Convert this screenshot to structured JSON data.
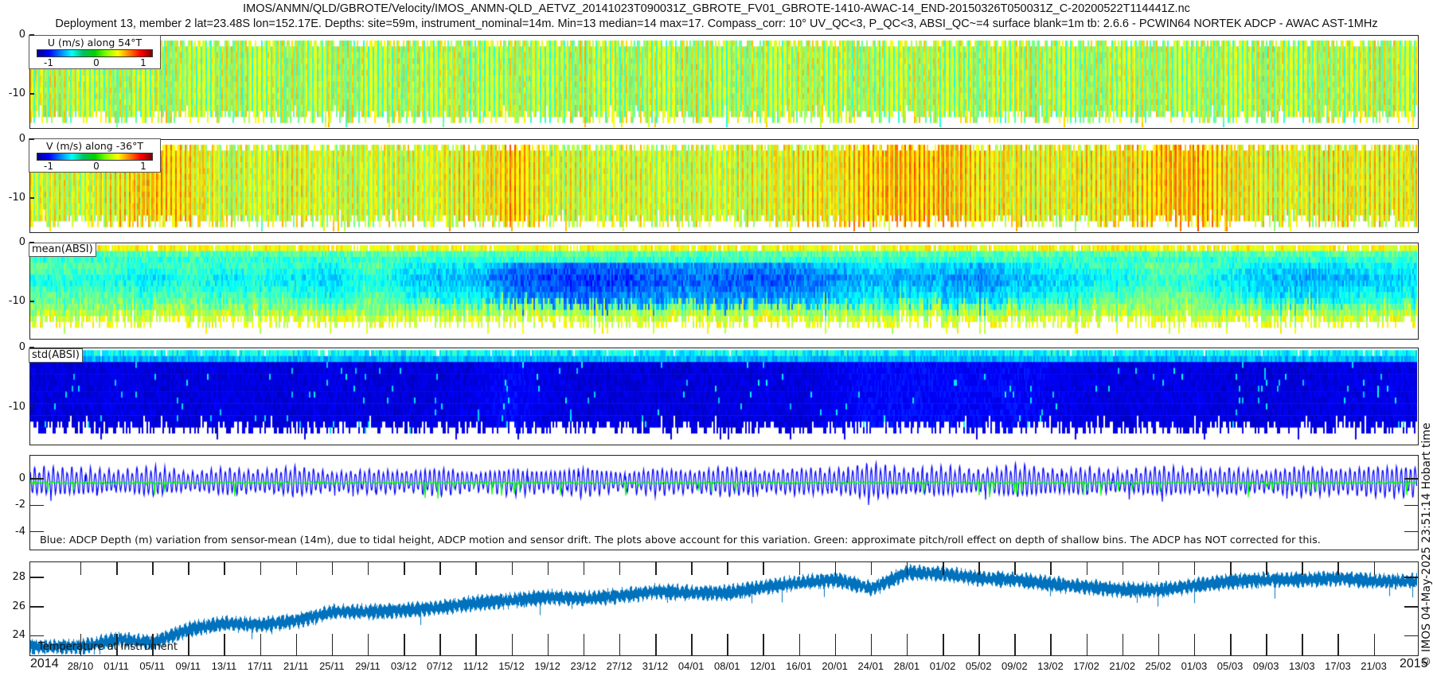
{
  "title_line1": "IMOS/ANMN/QLD/GBROTE/Velocity/IMOS_ANMN-QLD_AETVZ_20141023T090031Z_GBROTE_FV01_GBROTE-1410-AWAC-14_END-20150326T050031Z_C-20200522T114441Z.nc",
  "title_line2": "Deployment 13, member 2 lat=23.48S lon=152.17E. Depths: site=59m, instrument_nominal=14m. Min=13 median=14 max=17. Compass_corr: 10° UV_QC<3, P_QC<3, ABSI_QC~=4 surface blank=1m tb: 2.6.6 - PCWIN64 NORTEK ADCP - AWAC AST-1MHz",
  "timestamp_note": "© IMOS 04-May-2025 23:51:14 Hobart time",
  "x_axis": {
    "year_start": "2014",
    "year_end": "2015",
    "tick_labels": [
      "28/10",
      "01/11",
      "05/11",
      "09/11",
      "13/11",
      "17/11",
      "21/11",
      "25/11",
      "29/11",
      "03/12",
      "07/12",
      "11/12",
      "15/12",
      "19/12",
      "23/12",
      "27/12",
      "31/12",
      "04/01",
      "08/01",
      "12/01",
      "16/01",
      "20/01",
      "24/01",
      "28/01",
      "01/02",
      "05/02",
      "09/02",
      "13/02",
      "17/02",
      "21/02",
      "25/02",
      "01/03",
      "05/03",
      "09/03",
      "13/03",
      "17/03",
      "21/03"
    ],
    "tick_days_from_28_10": [
      0,
      4,
      8,
      12,
      16,
      20,
      24,
      28,
      32,
      36,
      40,
      44,
      48,
      52,
      56,
      60,
      64,
      68,
      72,
      76,
      80,
      84,
      88,
      92,
      96,
      100,
      104,
      108,
      112,
      116,
      120,
      124,
      128,
      132,
      136,
      140,
      144
    ],
    "xlim_days_from_28_10": [
      -5.67,
      149.0
    ]
  },
  "colors": {
    "tide_depth": "#0000ff",
    "pitch_roll": "#00ff00",
    "temperature": "#0072bd",
    "axis": "#222222"
  },
  "chart_data": [
    {
      "type": "heatmap",
      "name": "U",
      "colorbar_title": "U (m/s) along 54°T",
      "colorbar_ticks": [
        "-1",
        "0",
        "1"
      ],
      "clim": [
        -1.25,
        1.25
      ],
      "ylim": [
        -16,
        0
      ],
      "ytick_labels": [
        "0",
        "-10"
      ],
      "yticks": [
        0,
        -10
      ],
      "level_by_tick": [
        0.15,
        0.1,
        0.15,
        0.1,
        0.15,
        0.1,
        0.12,
        0.15,
        0.1,
        0.12,
        0.15,
        0.1,
        0.12,
        0.1,
        0.15,
        0.1,
        0.12,
        0.15,
        0.1,
        0.12,
        0.15,
        0.12,
        0.1,
        0.15,
        0.12,
        0.1,
        0.15,
        0.12,
        0.1,
        0.15,
        0.12,
        0.1,
        0.12,
        0.15,
        0.1,
        0.12,
        0.15
      ],
      "tidal_amplitude": 0.35
    },
    {
      "type": "heatmap",
      "name": "V",
      "colorbar_title": "V (m/s) along -36°T",
      "colorbar_ticks": [
        "-1",
        "0",
        "1"
      ],
      "clim": [
        -1.25,
        1.25
      ],
      "ylim": [
        -16,
        0
      ],
      "ytick_labels": [
        "0",
        "-10"
      ],
      "yticks": [
        0,
        -10
      ],
      "level_by_tick": [
        0.2,
        0.3,
        0.45,
        0.35,
        0.2,
        0.2,
        0.25,
        0.2,
        0.2,
        0.2,
        0.25,
        0.3,
        0.45,
        0.25,
        0.2,
        0.2,
        0.2,
        0.2,
        0.2,
        0.25,
        0.3,
        0.35,
        0.45,
        0.5,
        0.45,
        0.35,
        0.3,
        0.25,
        0.3,
        0.35,
        0.45,
        0.5,
        0.35,
        0.25,
        0.25,
        0.3,
        0.3
      ],
      "tidal_amplitude": 0.3
    },
    {
      "type": "heatmap",
      "name": "mean(ABSI)",
      "label": "mean(ABSI)",
      "clim": [
        0,
        1
      ],
      "ylim": [
        -16.5,
        0
      ],
      "ytick_labels": [
        "0",
        "-10"
      ],
      "yticks": [
        0,
        -10
      ],
      "level_by_tick": [
        0.4,
        0.38,
        0.35,
        0.4,
        0.35,
        0.38,
        0.35,
        0.32,
        0.42,
        0.33,
        0.3,
        0.3,
        0.2,
        0.17,
        0.17,
        0.17,
        0.2,
        0.22,
        0.2,
        0.2,
        0.22,
        0.25,
        0.3,
        0.28,
        0.28,
        0.25,
        0.3,
        0.32,
        0.35,
        0.38,
        0.42,
        0.4,
        0.35,
        0.3,
        0.28,
        0.3,
        0.32
      ]
    },
    {
      "type": "heatmap",
      "name": "std(ABSI)",
      "label": "std(ABSI)",
      "clim": [
        0,
        1
      ],
      "ylim": [
        -16.5,
        0
      ],
      "ytick_labels": [
        "0",
        "-10"
      ],
      "yticks": [
        0,
        -10
      ],
      "level_by_tick": [
        0.06,
        0.07,
        0.06,
        0.06,
        0.07,
        0.06,
        0.06,
        0.07,
        0.06,
        0.06,
        0.06,
        0.07,
        0.1,
        0.07,
        0.06,
        0.06,
        0.06,
        0.06,
        0.06,
        0.07,
        0.06,
        0.08,
        0.1,
        0.1,
        0.1,
        0.09,
        0.1,
        0.08,
        0.07,
        0.06,
        0.07,
        0.07,
        0.06,
        0.06,
        0.06,
        0.07,
        0.07
      ]
    },
    {
      "type": "line",
      "name": "depth-variation",
      "ylim": [
        -5.4,
        1.8
      ],
      "ytick_labels": [
        "0",
        "-2",
        "-4"
      ],
      "yticks": [
        0,
        -2,
        -4
      ],
      "annotation": "Blue: ADCP Depth (m) variation from sensor-mean (14m), due to tidal height, ADCP motion and sensor drift. The plots above account for this variation. Green: approximate pitch/roll effect on depth of shallow bins. The ADCP has NOT corrected for this.",
      "series": [
        {
          "name": "ADCP depth variation",
          "color": "blue",
          "tidal_amplitude_by_tick": [
            0.9,
            0.7,
            1.0,
            0.6,
            0.9,
            0.7,
            1.0,
            0.6,
            0.8,
            0.7,
            0.9,
            0.6,
            0.9,
            0.7,
            1.0,
            0.6,
            0.9,
            0.7,
            1.0,
            0.7,
            0.9,
            0.8,
            1.2,
            0.8,
            1.0,
            0.7,
            1.1,
            0.8,
            0.9,
            0.7,
            1.0,
            0.8,
            0.9,
            0.7,
            1.0,
            0.8,
            1.0
          ]
        },
        {
          "name": "pitch/roll effect",
          "color": "green"
        }
      ]
    },
    {
      "type": "line",
      "name": "temperature",
      "label": "Temperature at instrument",
      "ylim": [
        22.6,
        29.1
      ],
      "ytick_labels": [
        "24",
        "26",
        "28"
      ],
      "yticks": [
        24,
        26,
        28
      ],
      "series": [
        {
          "name": "Temperature",
          "values_by_tick": [
            23.3,
            23.8,
            23.6,
            24.5,
            24.9,
            24.8,
            25.1,
            25.7,
            25.7,
            25.8,
            26.0,
            26.3,
            26.5,
            26.7,
            26.6,
            26.8,
            27.1,
            27.0,
            27.0,
            27.4,
            27.7,
            27.9,
            27.3,
            28.4,
            28.3,
            28.0,
            27.9,
            27.6,
            27.4,
            27.2,
            27.2,
            27.5,
            27.8,
            27.9,
            27.9,
            28.0,
            27.8
          ]
        }
      ]
    }
  ]
}
